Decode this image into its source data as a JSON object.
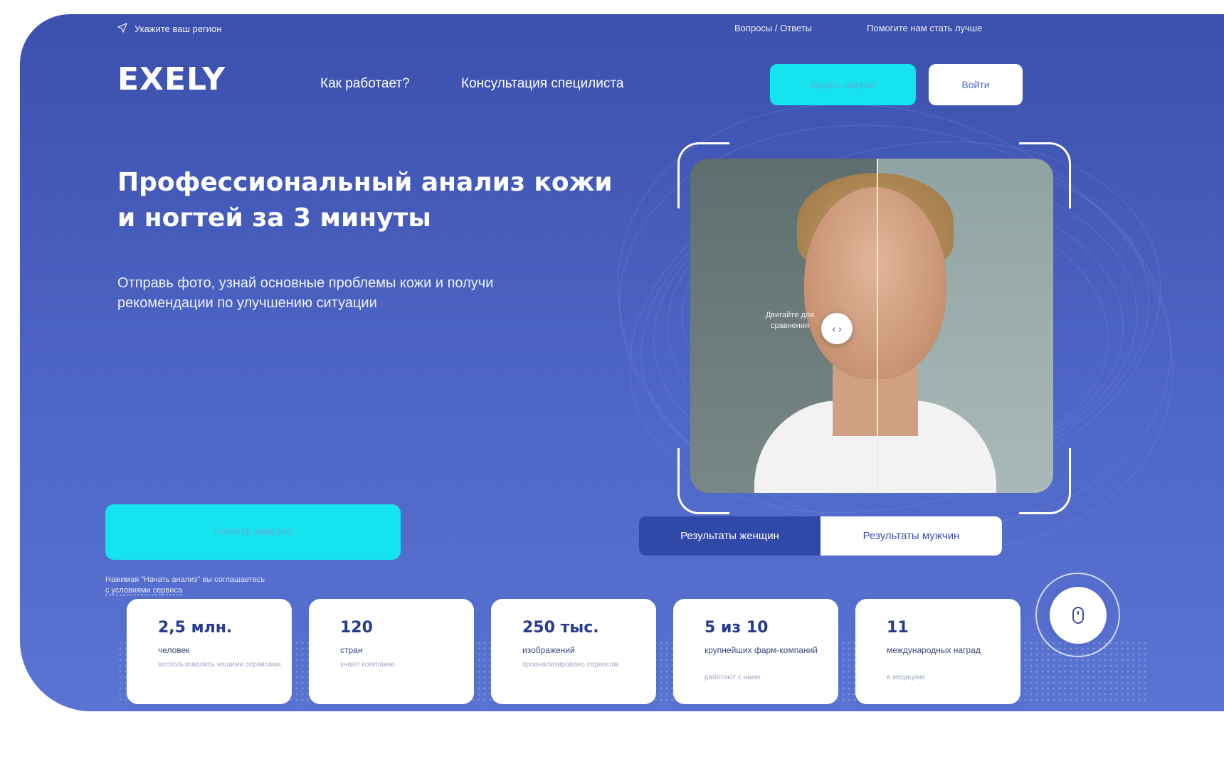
{
  "topbar": {
    "region_label": "Укажите ваш регион",
    "faq_link": "Вопросы / Ответы",
    "feedback_link": "Помогите нам стать лучше"
  },
  "header": {
    "logo": "EXELY",
    "nav": [
      "Как работает?",
      "Консультация специлиста"
    ],
    "ask_button": "Задать вопрос",
    "login_button": "Войти"
  },
  "hero": {
    "title": "Профессиональный анализ кожи и ногтей за 3 минуты",
    "subtitle": "Отправь фото, узнай основные проблемы кожи и получи рекомендации по улучшению ситуации",
    "cta": "Начать анализ",
    "consent_text": "Нажимая \"Начать анализ\" вы соглашаетесь",
    "consent_link": "с условиями сервиса",
    "compare_hint": "Двигайте для сравнения"
  },
  "results_toggle": {
    "women": "Результаты женщин",
    "men": "Результаты мужчин",
    "active": "women"
  },
  "stats": [
    {
      "number": "2,5 млн.",
      "label": "человек",
      "note": "воспользовались нашими сервисами"
    },
    {
      "number": "120",
      "label": "стран",
      "note": "знают компанию"
    },
    {
      "number": "250 тыс.",
      "label": "изображений",
      "note": "проанализировано сервисом"
    },
    {
      "number": "5 из 10",
      "label": "крупнейших фарм-компаний",
      "note": "работают с нами"
    },
    {
      "number": "11",
      "label": "международных наград",
      "note": "в медицине"
    }
  ],
  "colors": {
    "hero_bg": "#4e66c6",
    "accent_cyan": "#15e3ef",
    "stat_number": "#263a8f"
  }
}
